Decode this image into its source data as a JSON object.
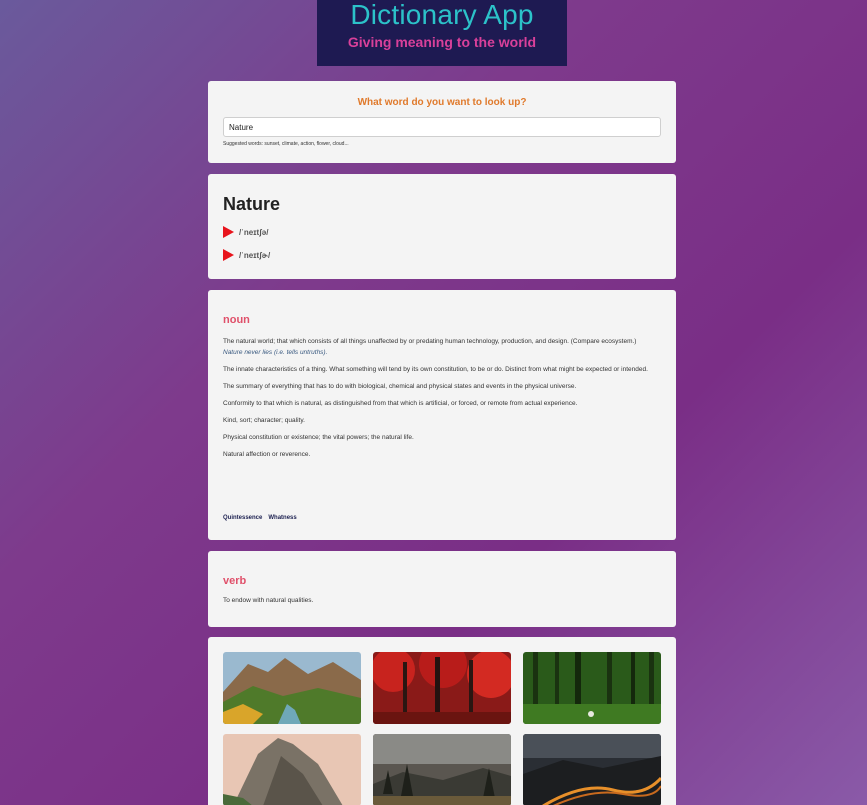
{
  "header": {
    "title": "Dictionary App",
    "subtitle": "Giving meaning to the world"
  },
  "search": {
    "prompt": "What word do you want to look up?",
    "value": "Nature",
    "suggested": "Suggested words: sunset, climate, action, flower, cloud..."
  },
  "word": {
    "title": "Nature",
    "phonetics": [
      {
        "text": "/ˈneɪtʃə/",
        "icon": "play-icon"
      },
      {
        "text": "/ˈneɪtʃɚ/",
        "icon": "play-icon"
      }
    ]
  },
  "meanings": [
    {
      "part_of_speech": "noun",
      "definitions": [
        {
          "text": "The natural world; that which consists of all things unaffected by or predating human technology, production, and design. (Compare ecosystem.)",
          "example": "Nature never lies (i.e. tells untruths)."
        },
        {
          "text": "The innate characteristics of a thing. What something will tend by its own constitution, to be or do. Distinct from what might be expected or intended."
        },
        {
          "text": "The summary of everything that has to do with biological, chemical and physical states and events in the physical universe."
        },
        {
          "text": "Conformity to that which is natural, as distinguished from that which is artificial, or forced, or remote from actual experience."
        },
        {
          "text": "Kind, sort; character; quality."
        },
        {
          "text": "Physical constitution or existence; the vital powers; the natural life."
        },
        {
          "text": "Natural affection or reverence."
        }
      ],
      "synonyms": [
        "Quintessence",
        "Whatness"
      ]
    },
    {
      "part_of_speech": "verb",
      "definitions": [
        {
          "text": "To endow with natural qualities."
        }
      ]
    }
  ],
  "photos": [
    {
      "subject": "canyon-river-photo"
    },
    {
      "subject": "red-forest-photo"
    },
    {
      "subject": "green-forest-photo"
    },
    {
      "subject": "rock-mountain-photo"
    },
    {
      "subject": "misty-forest-photo"
    },
    {
      "subject": "mountain-road-photo"
    }
  ],
  "colors": {
    "accent_orange": "#e07a2c",
    "pos_pink": "#e0506a",
    "play_red": "#e8141c",
    "banner_bg": "#1e1a52",
    "title_teal": "#2cc2c9",
    "subtitle_pink": "#d9409a"
  }
}
